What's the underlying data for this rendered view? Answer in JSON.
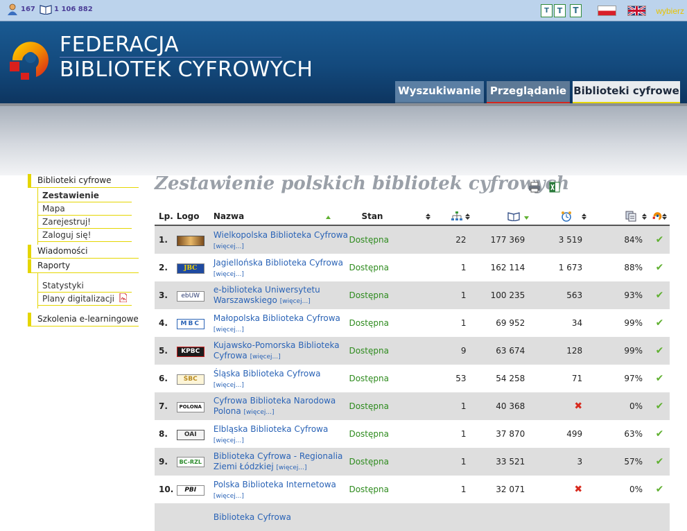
{
  "topbar": {
    "users_count": "167",
    "items_count": "1 106 882",
    "text_sizes": [
      "T",
      "T",
      "T"
    ],
    "language_choose": "wybierz"
  },
  "brand": {
    "line1": "FEDERACJA",
    "line2": "BIBLIOTEK CYFROWYCH"
  },
  "tabs": [
    {
      "label": "Wyszukiwanie"
    },
    {
      "label": "Przeglądanie"
    },
    {
      "label": "Biblioteki cyfrowe"
    }
  ],
  "sidebar": {
    "sections": [
      {
        "label": "Biblioteki cyfrowe",
        "items": [
          {
            "label": "Zestawienie"
          },
          {
            "label": "Mapa"
          },
          {
            "label": "Zarejestruj!"
          },
          {
            "label": "Zaloguj się!"
          }
        ]
      },
      {
        "label": "Wiadomości"
      },
      {
        "label": "Raporty",
        "items": [
          {
            "label": "Statystyki"
          },
          {
            "label": "Plany digitalizacji"
          }
        ]
      },
      {
        "label": "Szkolenia e-learningowe"
      }
    ]
  },
  "page": {
    "title": "Zestawienie polskich bibliotek cyfrowych"
  },
  "table": {
    "headers": {
      "lp": "Lp.",
      "logo": "Logo",
      "name": "Nazwa",
      "status": "Stan"
    },
    "more_label": "[więcej...]",
    "rows": [
      {
        "lp": "1.",
        "logo": "WBC",
        "name": "Wielkopolska Biblioteka Cyfrowa",
        "status": "Dostępna",
        "collections": "22",
        "publications": "177 369",
        "recent": "3 519",
        "percent": "84%",
        "oai": "ok",
        "recent_ok": true
      },
      {
        "lp": "2.",
        "logo": "JBC",
        "name": "Jagiellońska Biblioteka Cyfrowa",
        "status": "Dostępna",
        "collections": "1",
        "publications": "162 114",
        "recent": "1 673",
        "percent": "88%",
        "oai": "ok",
        "recent_ok": true
      },
      {
        "lp": "3.",
        "logo": "ebUW",
        "name": "e-biblioteka Uniwersytetu Warszawskiego",
        "status": "Dostępna",
        "collections": "1",
        "publications": "100 235",
        "recent": "563",
        "percent": "93%",
        "oai": "ok",
        "recent_ok": true
      },
      {
        "lp": "4.",
        "logo": "MBC",
        "name": "Małopolska Biblioteka Cyfrowa",
        "status": "Dostępna",
        "collections": "1",
        "publications": "69 952",
        "recent": "34",
        "percent": "99%",
        "oai": "ok",
        "recent_ok": true
      },
      {
        "lp": "5.",
        "logo": "KPBC",
        "name": "Kujawsko-Pomorska Biblioteka Cyfrowa",
        "status": "Dostępna",
        "collections": "9",
        "publications": "63 674",
        "recent": "128",
        "percent": "99%",
        "oai": "ok",
        "recent_ok": true
      },
      {
        "lp": "6.",
        "logo": "ŚBC",
        "name": "Śląska Biblioteka Cyfrowa",
        "status": "Dostępna",
        "collections": "53",
        "publications": "54 258",
        "recent": "71",
        "percent": "97%",
        "oai": "ok",
        "recent_ok": true
      },
      {
        "lp": "7.",
        "logo": "POLONA",
        "name": "Cyfrowa Biblioteka Narodowa Polona",
        "status": "Dostępna",
        "collections": "1",
        "publications": "40 368",
        "recent": "",
        "percent": "0%",
        "oai": "ok",
        "recent_ok": false
      },
      {
        "lp": "8.",
        "logo": "OAI",
        "name": "Elbląska Biblioteka Cyfrowa",
        "status": "Dostępna",
        "collections": "1",
        "publications": "37 870",
        "recent": "499",
        "percent": "63%",
        "oai": "ok",
        "recent_ok": true
      },
      {
        "lp": "9.",
        "logo": "BC-RZL",
        "name": "Biblioteka Cyfrowa - Regionalia Ziemi Łódzkiej",
        "status": "Dostępna",
        "collections": "1",
        "publications": "33 521",
        "recent": "3",
        "percent": "57%",
        "oai": "ok",
        "recent_ok": true
      },
      {
        "lp": "10.",
        "logo": "PBI",
        "name": "Polska Biblioteka Internetowa",
        "status": "Dostępna",
        "collections": "1",
        "publications": "32 071",
        "recent": "",
        "percent": "0%",
        "oai": "ok",
        "recent_ok": false
      },
      {
        "lp": "",
        "logo": "",
        "name": "Biblioteka Cyfrowa",
        "status": "",
        "collections": "",
        "publications": "",
        "recent": "",
        "percent": "",
        "oai": "",
        "recent_ok": true
      }
    ]
  },
  "colors": {
    "accent_yellow": "#e5d600",
    "header_blue": "#13497c",
    "status_green": "#2e8b1e",
    "link_blue": "#2a63b6"
  }
}
